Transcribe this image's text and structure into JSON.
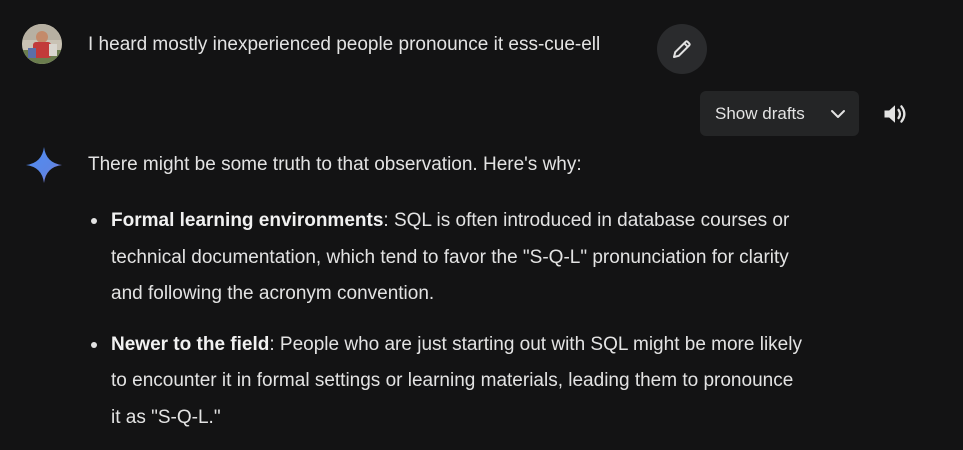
{
  "user_message": {
    "text": "I heard mostly inexperienced people pronounce it ess-cue-ell"
  },
  "toolbar": {
    "show_drafts_label": "Show drafts"
  },
  "response": {
    "intro": "There might be some truth to that observation. Here's why:",
    "bullets": [
      {
        "title": "Formal learning environments",
        "lines": [
          ": SQL is often introduced in database courses or",
          "technical documentation, which tend to favor the \"S-Q-L\" pronunciation for clarity",
          "and following the acronym convention."
        ]
      },
      {
        "title": "Newer to the field",
        "lines": [
          ": People who are just starting out with SQL might be more likely",
          "to encounter it in formal settings or learning materials, leading them to pronounce",
          "it as \"S-Q-L.\""
        ]
      }
    ]
  },
  "icons": {
    "edit": "pencil-icon",
    "drafts_toggle": "chevron-down-icon",
    "read_aloud": "speaker-icon",
    "assistant": "gemini-sparkle-icon"
  },
  "colors": {
    "background": "#131314",
    "text": "#e3e3e3",
    "chip": "#242526",
    "gemini_blue": "#4f8df5",
    "gemini_purple": "#9b72cb"
  }
}
